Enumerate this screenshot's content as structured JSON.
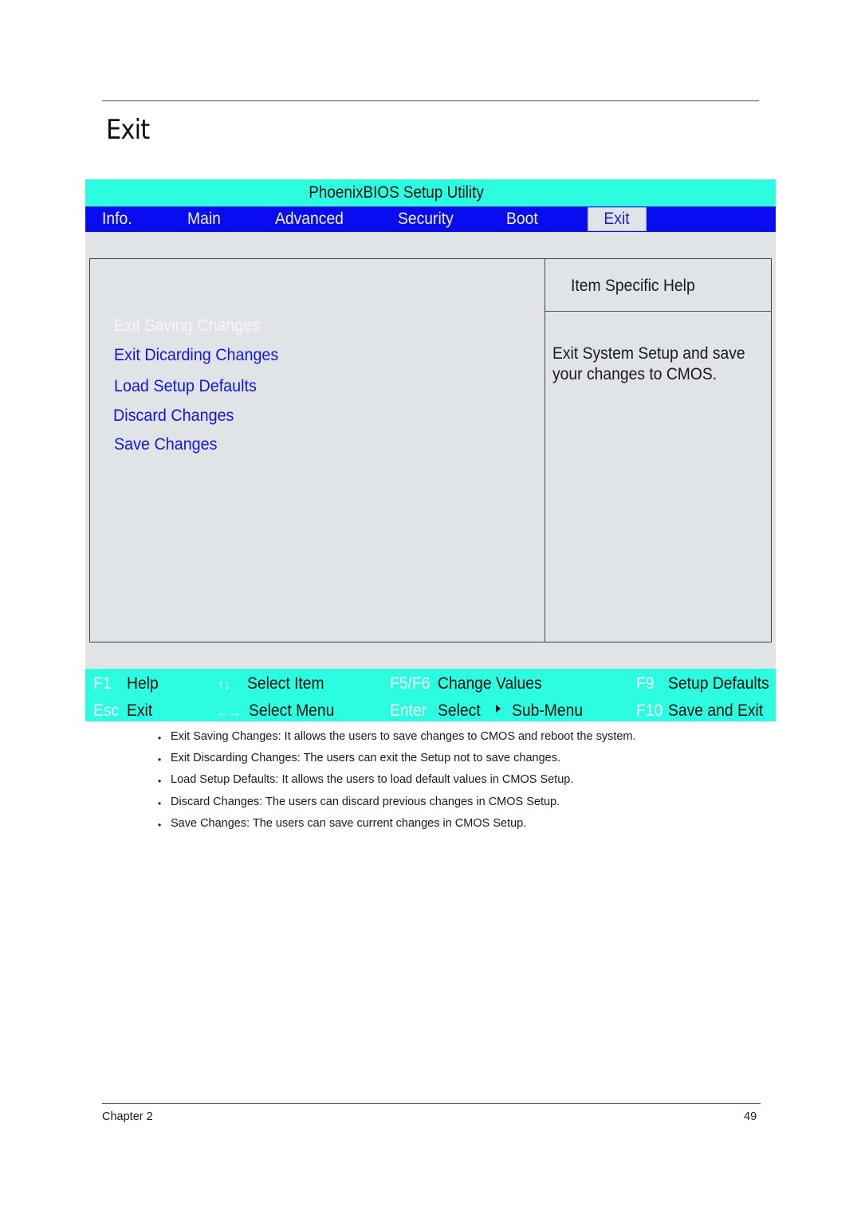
{
  "page": {
    "title": "Exit",
    "footer": {
      "chapter": "Chapter 2",
      "page_number": "49"
    }
  },
  "bios": {
    "title": "PhoenixBIOS Setup Utility",
    "tabs": [
      {
        "label": "Info.",
        "active": false
      },
      {
        "label": "Main",
        "active": false
      },
      {
        "label": "Advanced",
        "active": false
      },
      {
        "label": "Security",
        "active": false
      },
      {
        "label": "Boot",
        "active": false
      },
      {
        "label": "Exit",
        "active": true
      }
    ],
    "menu_items": [
      {
        "label": "Exit Saving Changes",
        "selected": true
      },
      {
        "label": "Exit Dicarding Changes",
        "selected": false
      },
      {
        "label": "Load Setup Defaults",
        "selected": false
      },
      {
        "label": "Discard Changes",
        "selected": false
      },
      {
        "label": "Save Changes",
        "selected": false
      }
    ],
    "help": {
      "title": "Item Specific Help",
      "text": "Exit System Setup and save your changes to CMOS."
    },
    "keybar": [
      {
        "key": "F1",
        "desc": "Help"
      },
      {
        "key": "↑↓",
        "desc": "Select Item"
      },
      {
        "key": "F5/F6",
        "desc": "Change Values"
      },
      {
        "key": "F9",
        "desc": "Setup Defaults"
      },
      {
        "key": "Esc",
        "desc": "Exit"
      },
      {
        "key": "←→",
        "desc": "Select Menu"
      },
      {
        "key": "Enter",
        "desc": "Select",
        "extra": "Sub-Menu"
      },
      {
        "key": "F10",
        "desc": "Save and Exit"
      }
    ],
    "colors": {
      "title_bar": "#2cfde0",
      "menu_bar": "#0a0cf0",
      "panel": "#e0e4e6",
      "item_text": "#1515e0",
      "selected_text": "#f6f6f6"
    }
  },
  "descriptions": [
    "Exit Saving Changes: It allows the users to save changes to CMOS and reboot the system.",
    "Exit Discarding Changes: The users can exit the Setup not to save changes.",
    "Load Setup Defaults: It allows the users to load default values in CMOS Setup.",
    "Discard Changes: The users can discard previous changes in CMOS Setup.",
    "Save Changes: The users can save current changes in CMOS Setup."
  ]
}
